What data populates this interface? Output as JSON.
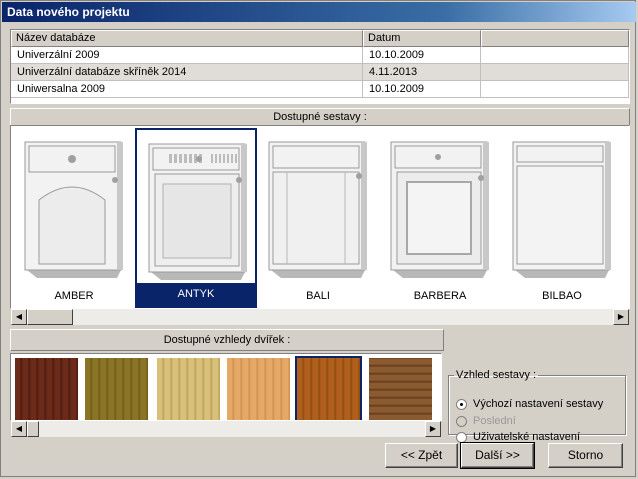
{
  "window": {
    "title": "Data nového projektu"
  },
  "database_table": {
    "columns": [
      "Název databáze",
      "Datum",
      ""
    ],
    "rows": [
      {
        "name": "Univerzální 2009",
        "date": "10.10.2009",
        "selected": false
      },
      {
        "name": "Univerzální databáze skříněk 2014",
        "date": "4.11.2013",
        "selected": true
      },
      {
        "name": "Uniwersalna 2009",
        "date": "10.10.2009",
        "selected": false
      }
    ]
  },
  "assemblies": {
    "header": "Dostupné sestavy :",
    "items": [
      {
        "label": "AMBER",
        "style": "arched",
        "selected": false
      },
      {
        "label": "ANTYK",
        "style": "vent",
        "selected": true
      },
      {
        "label": "BALI",
        "style": "split",
        "selected": false
      },
      {
        "label": "BARBERA",
        "style": "raised",
        "selected": false
      },
      {
        "label": "BILBAO",
        "style": "flat",
        "selected": false
      }
    ]
  },
  "door_looks": {
    "header": "Dostupné vzhledy dvířek :",
    "swatches": [
      {
        "name": "dark-cherry-wood",
        "color": "#6b2a1a",
        "grain": "#4a1a10",
        "selected": false
      },
      {
        "name": "olive-oak-wood",
        "color": "#8a7426",
        "grain": "#6c5a18",
        "selected": false
      },
      {
        "name": "light-birch-wood",
        "color": "#d8c07a",
        "grain": "#b89e55",
        "selected": false
      },
      {
        "name": "natural-beech-wood",
        "color": "#e6a866",
        "grain": "#cf8f4c",
        "selected": false
      },
      {
        "name": "teak-wood",
        "color": "#b0601c",
        "grain": "#8c4a12",
        "selected": true
      },
      {
        "name": "zebrano-wood",
        "color": "#8a5a30",
        "grain": "#5e3818",
        "selected": false
      }
    ]
  },
  "appearance_group": {
    "legend": "Vzhled sestavy :",
    "options": [
      {
        "label": "Výchozí nastavení sestavy",
        "checked": true,
        "disabled": false
      },
      {
        "label": "Poslední",
        "checked": false,
        "disabled": true
      },
      {
        "label": "Uživatelské nastavení",
        "checked": false,
        "disabled": false
      }
    ]
  },
  "buttons": {
    "back": "<< Zpět",
    "next": "Další >>",
    "cancel": "Storno"
  },
  "colors": {
    "title_bar": "#0a246a",
    "selection": "#0a246a",
    "face": "#d4d0c8"
  }
}
